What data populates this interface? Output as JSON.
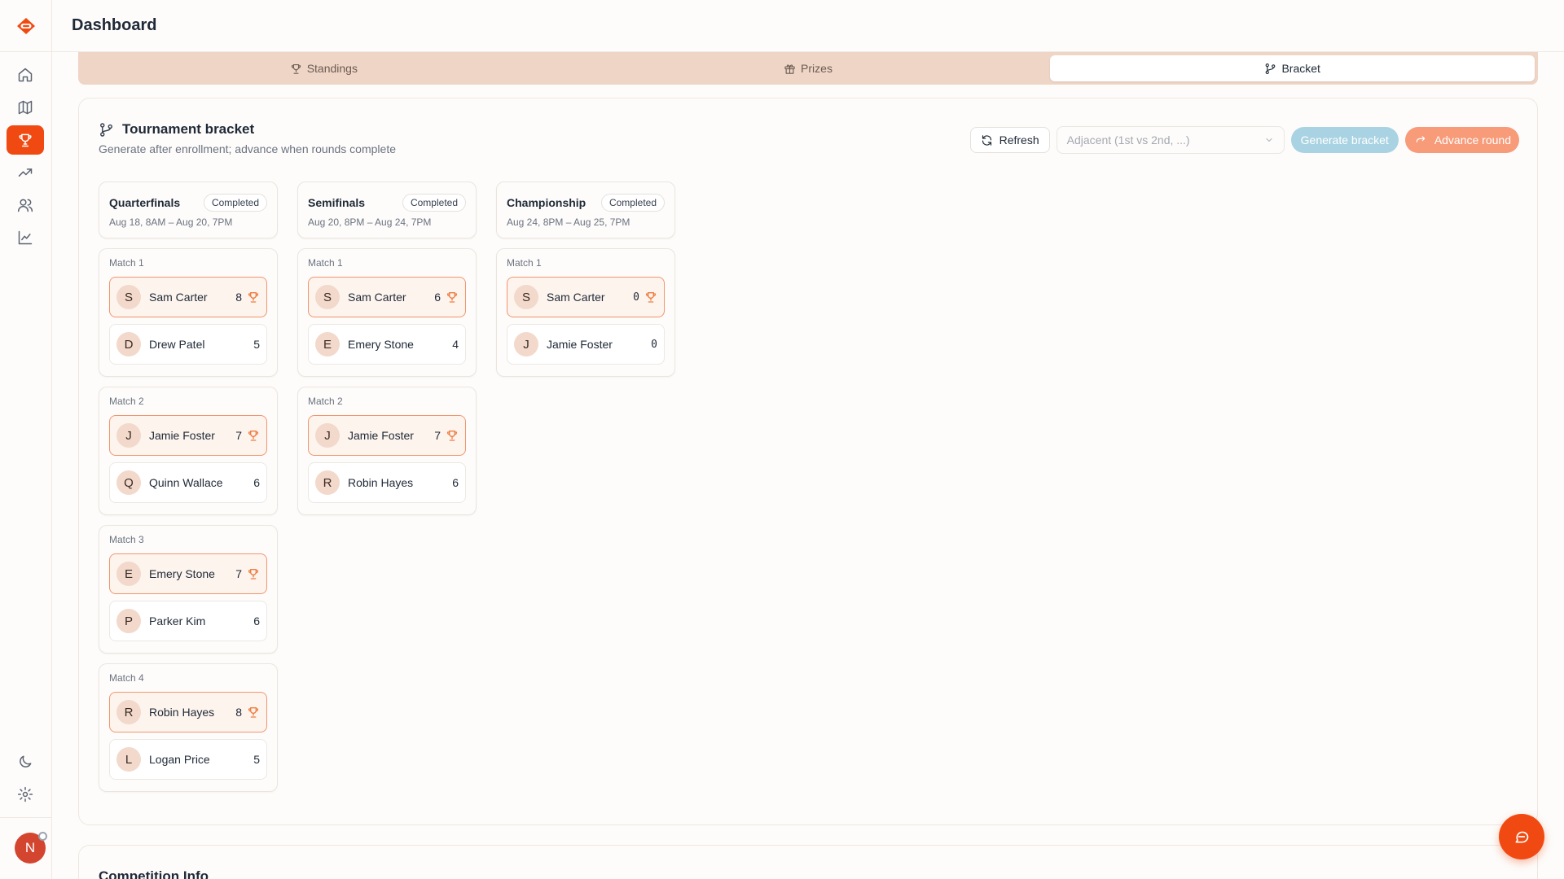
{
  "header": {
    "title": "Dashboard"
  },
  "sidebar": {
    "nav": [
      {
        "icon": "home-icon",
        "active": false
      },
      {
        "icon": "map-icon",
        "active": false
      },
      {
        "icon": "trophy-icon",
        "active": true
      },
      {
        "icon": "trending-up-icon",
        "active": false
      },
      {
        "icon": "users-icon",
        "active": false
      },
      {
        "icon": "chart-line-icon",
        "active": false
      }
    ],
    "bottom": [
      {
        "icon": "moon-icon"
      },
      {
        "icon": "gear-icon"
      }
    ],
    "avatar_initial": "N"
  },
  "tabs": [
    {
      "label": "Standings",
      "icon": "trophy-icon",
      "active": false
    },
    {
      "label": "Prizes",
      "icon": "gift-icon",
      "active": false
    },
    {
      "label": "Bracket",
      "icon": "branch-icon",
      "active": true
    }
  ],
  "bracket": {
    "title": "Tournament bracket",
    "subtitle": "Generate after enrollment; advance when rounds complete",
    "refresh_label": "Refresh",
    "pairing_select": "Adjacent (1st vs 2nd, ...)",
    "generate_label": "Generate bracket",
    "advance_label": "Advance round",
    "colors": {
      "accent": "#F04A12",
      "winner_border": "#F2956E",
      "generate": "#A9D3E2",
      "advance": "#F79B79"
    },
    "rounds": [
      {
        "name": "Quarterfinals",
        "status": "Completed",
        "dates": "Aug 18, 8AM – Aug 20, 7PM",
        "matches": [
          {
            "label": "Match 1",
            "players": [
              {
                "initial": "S",
                "name": "Sam Carter",
                "score": "8",
                "winner": true
              },
              {
                "initial": "D",
                "name": "Drew Patel",
                "score": "5",
                "winner": false
              }
            ]
          },
          {
            "label": "Match 2",
            "players": [
              {
                "initial": "J",
                "name": "Jamie Foster",
                "score": "7",
                "winner": true
              },
              {
                "initial": "Q",
                "name": "Quinn Wallace",
                "score": "6",
                "winner": false
              }
            ]
          },
          {
            "label": "Match 3",
            "players": [
              {
                "initial": "E",
                "name": "Emery Stone",
                "score": "7",
                "winner": true
              },
              {
                "initial": "P",
                "name": "Parker Kim",
                "score": "6",
                "winner": false
              }
            ]
          },
          {
            "label": "Match 4",
            "players": [
              {
                "initial": "R",
                "name": "Robin Hayes",
                "score": "8",
                "winner": true
              },
              {
                "initial": "L",
                "name": "Logan Price",
                "score": "5",
                "winner": false
              }
            ]
          }
        ]
      },
      {
        "name": "Semifinals",
        "status": "Completed",
        "dates": "Aug 20, 8PM – Aug 24, 7PM",
        "matches": [
          {
            "label": "Match 1",
            "players": [
              {
                "initial": "S",
                "name": "Sam Carter",
                "score": "6",
                "winner": true
              },
              {
                "initial": "E",
                "name": "Emery Stone",
                "score": "4",
                "winner": false
              }
            ]
          },
          {
            "label": "Match 2",
            "players": [
              {
                "initial": "J",
                "name": "Jamie Foster",
                "score": "7",
                "winner": true
              },
              {
                "initial": "R",
                "name": "Robin Hayes",
                "score": "6",
                "winner": false
              }
            ]
          }
        ]
      },
      {
        "name": "Championship",
        "status": "Completed",
        "dates": "Aug 24, 8PM – Aug 25, 7PM",
        "matches": [
          {
            "label": "Match 1",
            "players": [
              {
                "initial": "S",
                "name": "Sam Carter",
                "score": "0",
                "winner": true
              },
              {
                "initial": "J",
                "name": "Jamie Foster",
                "score": "0",
                "winner": false
              }
            ]
          }
        ]
      }
    ]
  },
  "competition_info": {
    "title": "Competition Info"
  }
}
